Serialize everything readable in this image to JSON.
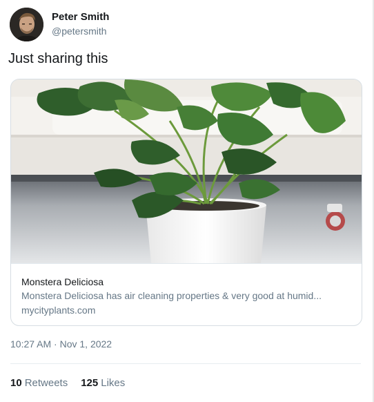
{
  "author": {
    "name": "Peter Smith",
    "handle": "@petersmith"
  },
  "tweet": {
    "text": "Just sharing this",
    "timestamp": "10:27 AM · Nov 1, 2022"
  },
  "card": {
    "title": "Monstera Deliciosa",
    "description": "Monstera Deliciosa has air cleaning properties & very good at humid...",
    "domain": "mycityplants.com"
  },
  "stats": {
    "retweets_count": "10",
    "retweets_label": "Retweets",
    "likes_count": "125",
    "likes_label": "Likes"
  },
  "colors": {
    "text_primary": "#14171a",
    "text_secondary": "#657786",
    "border": "#d6dde3"
  }
}
